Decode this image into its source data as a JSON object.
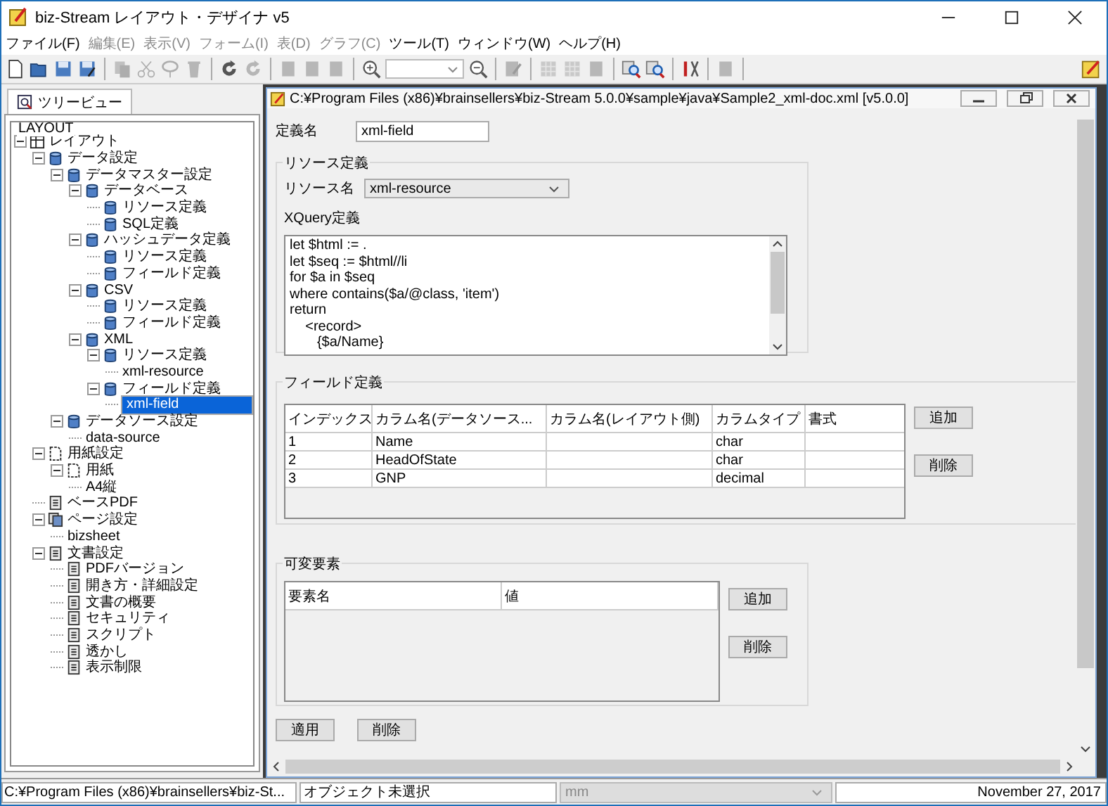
{
  "window": {
    "title": "biz-Stream レイアウト・デザイナ v5"
  },
  "menu": [
    {
      "label": "ファイル(F)",
      "disabled": false
    },
    {
      "label": "編集(E)",
      "disabled": true
    },
    {
      "label": "表示(V)",
      "disabled": true
    },
    {
      "label": "フォーム(I)",
      "disabled": true
    },
    {
      "label": "表(D)",
      "disabled": true
    },
    {
      "label": "グラフ(C)",
      "disabled": true
    },
    {
      "label": "ツール(T)",
      "disabled": false
    },
    {
      "label": "ウィンドウ(W)",
      "disabled": false
    },
    {
      "label": "ヘルプ(H)",
      "disabled": false
    }
  ],
  "toolbar": [
    {
      "kind": "new",
      "disabled": false
    },
    {
      "kind": "open",
      "disabled": false
    },
    {
      "kind": "save",
      "disabled": false
    },
    {
      "kind": "saveas",
      "disabled": false
    },
    {
      "kind": "sep"
    },
    {
      "kind": "copy",
      "disabled": true
    },
    {
      "kind": "cut",
      "disabled": true
    },
    {
      "kind": "lasso",
      "disabled": true
    },
    {
      "kind": "trash",
      "disabled": true
    },
    {
      "kind": "sep"
    },
    {
      "kind": "undo",
      "disabled": false
    },
    {
      "kind": "redo",
      "disabled": true
    },
    {
      "kind": "sep"
    },
    {
      "kind": "page",
      "disabled": true
    },
    {
      "kind": "page",
      "disabled": true
    },
    {
      "kind": "page",
      "disabled": true
    },
    {
      "kind": "sep"
    },
    {
      "kind": "zoomin",
      "disabled": false
    },
    {
      "kind": "combo",
      "disabled": false
    },
    {
      "kind": "zoomout",
      "disabled": false
    },
    {
      "kind": "sep"
    },
    {
      "kind": "edit",
      "disabled": true
    },
    {
      "kind": "sep"
    },
    {
      "kind": "grid",
      "disabled": true
    },
    {
      "kind": "grid",
      "disabled": true
    },
    {
      "kind": "page",
      "disabled": true
    },
    {
      "kind": "sep"
    },
    {
      "kind": "find",
      "disabled": false
    },
    {
      "kind": "findlist",
      "disabled": false
    },
    {
      "kind": "sep"
    },
    {
      "kind": "tools",
      "disabled": false
    },
    {
      "kind": "sep"
    },
    {
      "kind": "page",
      "disabled": true
    },
    {
      "kind": "sep"
    }
  ],
  "side_tab": {
    "label": "ツリービュー"
  },
  "tree_group": {
    "label": "LAYOUT"
  },
  "tree": [
    {
      "label": "レイアウト",
      "kind": "layout",
      "selected": false,
      "expanded": true,
      "children": [
        {
          "label": "データ設定",
          "kind": "db",
          "selected": false,
          "expanded": true,
          "children": [
            {
              "label": "データマスター設定",
              "kind": "db",
              "selected": false,
              "expanded": true,
              "children": [
                {
                  "label": "データベース",
                  "kind": "db",
                  "selected": false,
                  "expanded": true,
                  "children": [
                    {
                      "label": "リソース定義",
                      "kind": "db",
                      "selected": false
                    },
                    {
                      "label": "SQL定義",
                      "kind": "db",
                      "selected": false
                    }
                  ]
                },
                {
                  "label": "ハッシュデータ定義",
                  "kind": "db",
                  "selected": false,
                  "expanded": true,
                  "children": [
                    {
                      "label": "リソース定義",
                      "kind": "db",
                      "selected": false
                    },
                    {
                      "label": "フィールド定義",
                      "kind": "db",
                      "selected": false
                    }
                  ]
                },
                {
                  "label": "CSV",
                  "kind": "db",
                  "selected": false,
                  "expanded": true,
                  "children": [
                    {
                      "label": "リソース定義",
                      "kind": "db",
                      "selected": false
                    },
                    {
                      "label": "フィールド定義",
                      "kind": "db",
                      "selected": false
                    }
                  ]
                },
                {
                  "label": "XML",
                  "kind": "db",
                  "selected": false,
                  "expanded": true,
                  "children": [
                    {
                      "label": "リソース定義",
                      "kind": "db",
                      "selected": false,
                      "expanded": true,
                      "children": [
                        {
                          "label": "xml-resource",
                          "selected": false
                        }
                      ]
                    },
                    {
                      "label": "フィールド定義",
                      "kind": "db",
                      "selected": false,
                      "expanded": true,
                      "children": [
                        {
                          "label": "xml-field",
                          "selected": true
                        }
                      ]
                    }
                  ]
                }
              ]
            },
            {
              "label": "データソース設定",
              "kind": "db",
              "selected": false,
              "expanded": true,
              "children": [
                {
                  "label": "data-source",
                  "selected": false
                }
              ]
            }
          ]
        },
        {
          "label": "用紙設定",
          "kind": "paper",
          "selected": false,
          "expanded": true,
          "children": [
            {
              "label": "用紙",
              "kind": "paper",
              "selected": false,
              "expanded": true,
              "children": [
                {
                  "label": "A4縦",
                  "selected": false
                }
              ]
            }
          ]
        },
        {
          "label": "ベースPDF",
          "kind": "doc",
          "selected": false
        },
        {
          "label": "ページ設定",
          "kind": "pages",
          "selected": false,
          "expanded": true,
          "children": [
            {
              "label": "bizsheet",
              "selected": false
            }
          ]
        },
        {
          "label": "文書設定",
          "kind": "doc",
          "selected": false,
          "expanded": true,
          "children": [
            {
              "label": "PDFバージョン",
              "kind": "doc",
              "selected": false
            },
            {
              "label": "開き方・詳細設定",
              "kind": "doc",
              "selected": false
            },
            {
              "label": "文書の概要",
              "kind": "doc",
              "selected": false
            },
            {
              "label": "セキュリティ",
              "kind": "doc",
              "selected": false
            },
            {
              "label": "スクリプト",
              "kind": "doc",
              "selected": false
            },
            {
              "label": "透かし",
              "kind": "doc",
              "selected": false
            },
            {
              "label": "表示制限",
              "kind": "doc",
              "selected": false
            }
          ]
        }
      ]
    }
  ],
  "document": {
    "title": "C:¥Program Files (x86)¥brainsellers¥biz-Stream 5.0.0¥sample¥java¥Sample2_xml-doc.xml [v5.0.0]",
    "name_label": "定義名",
    "name_value": "xml-field",
    "resource_group": "リソース定義",
    "resource_label": "リソース名",
    "resource_value": "xml-resource",
    "xquery_label": "XQuery定義",
    "xquery_lines": [
      "let $html := .",
      "let $seq := $html//li",
      "for $a in $seq",
      "where contains($a/@class, 'item')",
      "return",
      "    <record>",
      "       {$a/Name}"
    ],
    "fields_group": "フィールド定義",
    "fields_columns": [
      "インデックス",
      "カラム名(データソース...",
      "カラム名(レイアウト側)",
      "カラムタイプ",
      "書式"
    ],
    "fields_rows": [
      [
        "1",
        "Name",
        "",
        "char",
        ""
      ],
      [
        "2",
        "HeadOfState",
        "",
        "char",
        ""
      ],
      [
        "3",
        "GNP",
        "",
        "decimal",
        ""
      ]
    ],
    "fields_buttons": [
      "追加",
      "削除"
    ],
    "vars_group": "可変要素",
    "vars_columns": [
      "要素名",
      "値"
    ],
    "vars_buttons": [
      "追加",
      "削除"
    ],
    "buttons": [
      "適用",
      "削除"
    ]
  },
  "status_bar": {
    "path": "C:¥Program Files (x86)¥brainsellers¥biz-St...",
    "selection": "オブジェクト未選択",
    "unit": "mm",
    "date": "November 27, 2017"
  }
}
